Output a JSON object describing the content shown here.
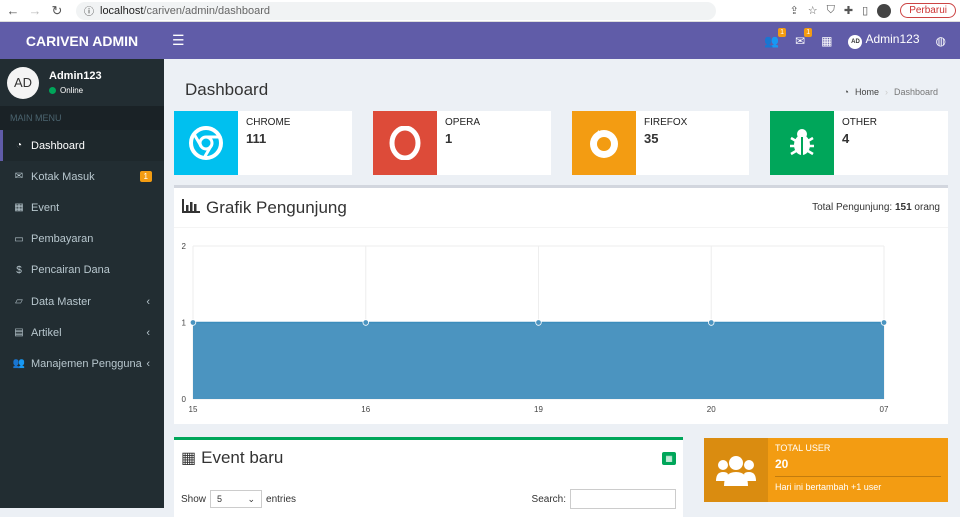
{
  "browser": {
    "url_host": "localhost",
    "url_path": "/cariven/admin/dashboard",
    "update_label": "Perbarui"
  },
  "header": {
    "logo": "CARIVEN ADMIN",
    "user": "Admin123",
    "user_initials": "AD",
    "badge_visitors": "1",
    "badge_mail": "1"
  },
  "sidebar": {
    "user_initials": "AD",
    "user_name": "Admin123",
    "status": "Online",
    "menu_header": "MAIN MENU",
    "items": [
      {
        "label": "Dashboard",
        "icon": "dashboard-icon"
      },
      {
        "label": "Kotak Masuk",
        "icon": "envelope-icon",
        "badge": "1"
      },
      {
        "label": "Event",
        "icon": "calendar-icon"
      },
      {
        "label": "Pembayaran",
        "icon": "money-icon"
      },
      {
        "label": "Pencairan Dana",
        "icon": "dollar-icon"
      },
      {
        "label": "Data Master",
        "icon": "folder-icon"
      },
      {
        "label": "Artikel",
        "icon": "newspaper-icon"
      },
      {
        "label": "Manajemen Pengguna",
        "icon": "users-icon"
      }
    ]
  },
  "content": {
    "title": "Dashboard",
    "breadcrumb_home": "Home",
    "breadcrumb_current": "Dashboard",
    "stats": [
      {
        "label": "CHROME",
        "value": "111",
        "color": "#00c0ef"
      },
      {
        "label": "OPERA",
        "value": "1",
        "color": "#dd4b39"
      },
      {
        "label": "FIREFOX",
        "value": "35",
        "color": "#f39c12"
      },
      {
        "label": "OTHER",
        "value": "4",
        "color": "#00a65a"
      }
    ],
    "chart_title": "Grafik Pengunjung",
    "total_label": "Total Pengunjung:",
    "total_value": "151",
    "total_unit": "orang",
    "event_title": "Event baru",
    "show_label": "Show",
    "entries_value": "5",
    "entries_label": "entries",
    "search_label": "Search:",
    "total_user_label": "TOTAL USER",
    "total_user_value": "20",
    "total_user_desc": "Hari ini bertambah +1 user"
  },
  "chart_data": {
    "type": "area",
    "categories": [
      "15",
      "16",
      "19",
      "20",
      "07"
    ],
    "values": [
      1,
      1,
      1,
      1,
      1
    ],
    "ylim": [
      0,
      2
    ],
    "yticks": [
      0,
      1,
      2
    ],
    "grid": true,
    "color": "#4b94c0"
  }
}
